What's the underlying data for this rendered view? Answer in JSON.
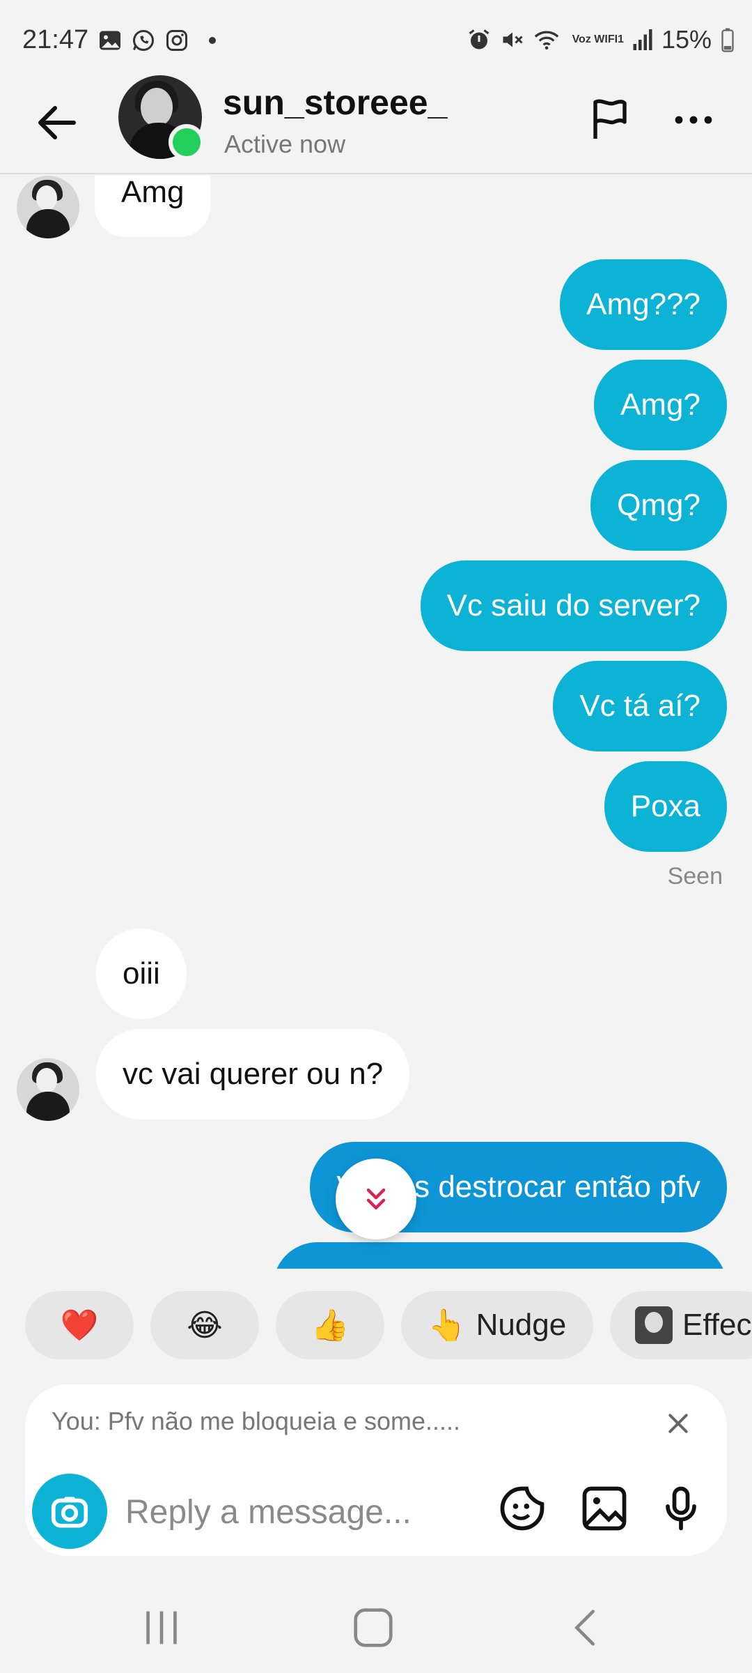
{
  "status_bar": {
    "time": "21:47",
    "battery": "15%",
    "left_icons": [
      "gallery-icon",
      "whatsapp-icon",
      "instagram-icon"
    ],
    "right_icons": [
      "alarm-icon",
      "mute-icon",
      "wifi-calling-icon",
      "signal-icon",
      "battery-icon"
    ],
    "wifi_label": "Voz WIFI1"
  },
  "header": {
    "username": "sun_storeee_",
    "status": "Active now"
  },
  "messages": [
    {
      "from": "them",
      "text": "Amg"
    },
    {
      "from": "me",
      "text": "Amg???"
    },
    {
      "from": "me",
      "text": "Amg?"
    },
    {
      "from": "me",
      "text": "Qmg?"
    },
    {
      "from": "me",
      "text": "Vc saiu do server?"
    },
    {
      "from": "me",
      "text": "Vc tá aí?"
    },
    {
      "from": "me",
      "text": "Poxa"
    },
    {
      "from": "them",
      "text": "oiii"
    },
    {
      "from": "them",
      "text": "vc vai querer ou n?"
    },
    {
      "from": "me",
      "text": "Vamos destrocar então pfv"
    }
  ],
  "seen_label": "Seen",
  "reactions": [
    {
      "icon": "heart-emoji",
      "label": "❤️"
    },
    {
      "icon": "laughing-emoji",
      "label": "😂"
    },
    {
      "icon": "thumbs-up-emoji",
      "label": "👍"
    },
    {
      "icon": "pointing-hand-emoji",
      "label": "👆",
      "text": "Nudge"
    },
    {
      "icon": "effect-thumbnail",
      "text": "Effec"
    }
  ],
  "composer": {
    "reply_preview": "You: Pfv não me bloqueia e some.....",
    "placeholder": "Reply a message..."
  },
  "colors": {
    "outgoing_bubble": "#0db3d4",
    "outgoing_bubble_latest": "#0e95d6",
    "incoming_bubble": "#ffffff",
    "online": "#22cf5b",
    "scroll_arrow": "#d6244e"
  }
}
